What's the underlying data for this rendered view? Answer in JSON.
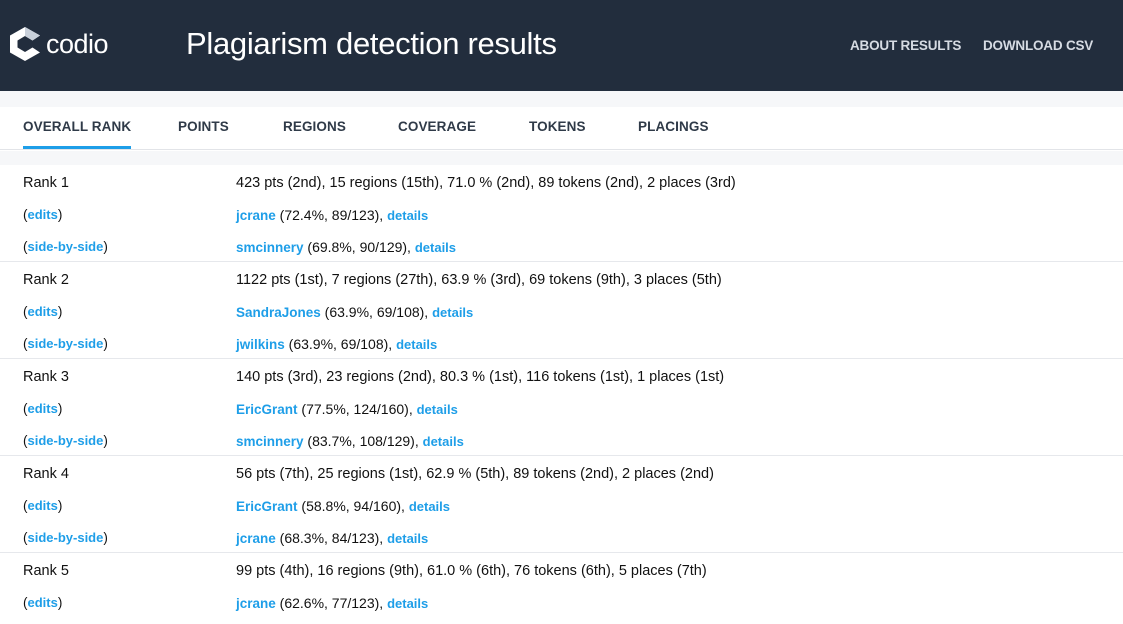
{
  "header": {
    "logo_text": "codio",
    "title": "Plagiarism detection results",
    "links": [
      "ABOUT RESULTS",
      "DOWNLOAD CSV"
    ]
  },
  "tabs": [
    {
      "label": "OVERALL RANK",
      "active": true
    },
    {
      "label": "POINTS",
      "active": false
    },
    {
      "label": "REGIONS",
      "active": false
    },
    {
      "label": "COVERAGE",
      "active": false
    },
    {
      "label": "TOKENS",
      "active": false
    },
    {
      "label": "PLACINGS",
      "active": false
    }
  ],
  "labels": {
    "edits": "edits",
    "side_by_side": "side-by-side",
    "details": "details"
  },
  "ranks": [
    {
      "rank": "Rank 1",
      "summary": "423 pts (2nd), 15 regions (15th), 71.0 % (2nd), 89 tokens (2nd), 2 places (3rd)",
      "matches": [
        {
          "user": "jcrane",
          "stats": " (72.4%, 89/123), "
        },
        {
          "user": "smcinnery",
          "stats": " (69.8%, 90/129), "
        }
      ]
    },
    {
      "rank": "Rank 2",
      "summary": "1122 pts (1st), 7 regions (27th), 63.9 % (3rd), 69 tokens (9th), 3 places (5th)",
      "matches": [
        {
          "user": "SandraJones",
          "stats": " (63.9%, 69/108), "
        },
        {
          "user": "jwilkins",
          "stats": " (63.9%, 69/108), "
        }
      ]
    },
    {
      "rank": "Rank 3",
      "summary": "140 pts (3rd), 23 regions (2nd), 80.3 % (1st), 116 tokens (1st), 1 places (1st)",
      "matches": [
        {
          "user": "EricGrant",
          "stats": " (77.5%, 124/160), "
        },
        {
          "user": "smcinnery",
          "stats": " (83.7%, 108/129), "
        }
      ]
    },
    {
      "rank": "Rank 4",
      "summary": "56 pts (7th), 25 regions (1st), 62.9 % (5th), 89 tokens (2nd), 2 places (2nd)",
      "matches": [
        {
          "user": "EricGrant",
          "stats": " (58.8%, 94/160), "
        },
        {
          "user": "jcrane",
          "stats": " (68.3%, 84/123), "
        }
      ]
    },
    {
      "rank": "Rank 5",
      "summary": "99 pts (4th), 16 regions (9th), 61.0 % (6th), 76 tokens (6th), 5 places (7th)",
      "matches": [
        {
          "user": "jcrane",
          "stats": " (62.6%, 77/123), "
        }
      ]
    }
  ],
  "colors": {
    "header_bg": "#222d3d",
    "accent": "#1e9ee8",
    "band": "#f6f7f9"
  }
}
